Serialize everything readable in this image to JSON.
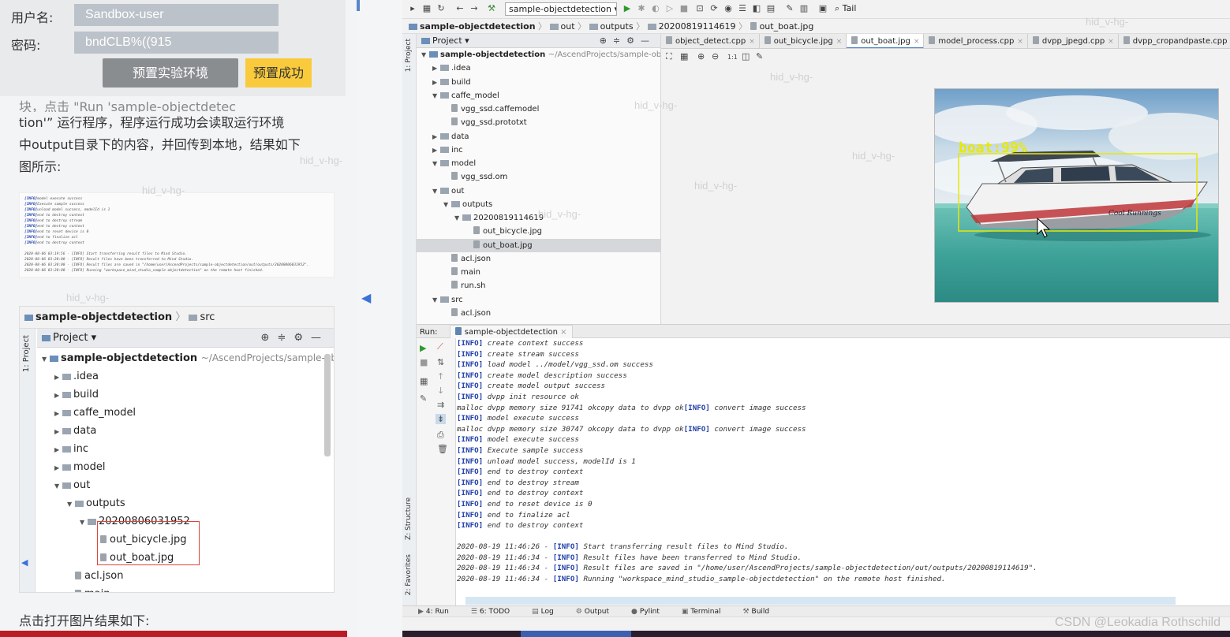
{
  "tutorial": {
    "username_label": "用户名:",
    "username_value": "Sandbox-user",
    "password_label": "密码:",
    "password_value": "bndCLB%((915",
    "preset_button": "预置实验环境",
    "preset_status": "预置成功",
    "paragraph_partial": "块，点击 \"Run 'sample-objectdetec",
    "paragraph_lines": [
      "tion'” 运行程序，程序运行成功会读取运行环境",
      "中output目录下的内容，并回传到本地，结果如下",
      "图所示:"
    ],
    "log_thumb_lines": [
      {
        "tag": "[INFO]",
        "text": "model execute success"
      },
      {
        "tag": "[INFO]",
        "text": "Execute sample success"
      },
      {
        "tag": "[INFO]",
        "text": "unload model success, modelId is 1"
      },
      {
        "tag": "[INFO]",
        "text": "end to destroy context"
      },
      {
        "tag": "[INFO]",
        "text": "end to destroy stream"
      },
      {
        "tag": "[INFO]",
        "text": "end to destroy context"
      },
      {
        "tag": "[INFO]",
        "text": "end to reset device is 0"
      },
      {
        "tag": "[INFO]",
        "text": "end to finalize acl"
      },
      {
        "tag": "[INFO]",
        "text": "end to destroy context"
      },
      {
        "tag": "",
        "text": ""
      },
      {
        "tag": "",
        "text": "2020-08-06 03:19:56 - [INFO] Start transferring result files to Mind Studio."
      },
      {
        "tag": "",
        "text": "2020-08-06 03:20:00 - [INFO] Result files have been transferred to Mind Studio."
      },
      {
        "tag": "",
        "text": "2020-08-06 03:20:00 - [INFO] Result files are saved in \"/home/user/AscendProjects/sample-objectdetection/out/outputs/20200806031952\"."
      },
      {
        "tag": "",
        "text": "2020-08-06 03:20:00 - [INFO] Running \"workspace_mind_studio_sample-objectdetection\" on the remote host finished."
      }
    ],
    "tree_shot": {
      "breadcrumb_project": "sample-objectdetection",
      "breadcrumb_folder": "src",
      "sidebar_label": "1: Project",
      "header": "Project",
      "rows": [
        {
          "label": "sample-objectdetection",
          "path": "~/AscendProjects/sample-objec",
          "indent": 0,
          "kind": "project",
          "open": true
        },
        {
          "label": ".idea",
          "indent": 1,
          "kind": "folder",
          "open": false
        },
        {
          "label": "build",
          "indent": 1,
          "kind": "folder",
          "open": false
        },
        {
          "label": "caffe_model",
          "indent": 1,
          "kind": "folder",
          "open": false
        },
        {
          "label": "data",
          "indent": 1,
          "kind": "folder",
          "open": false
        },
        {
          "label": "inc",
          "indent": 1,
          "kind": "folder",
          "open": false
        },
        {
          "label": "model",
          "indent": 1,
          "kind": "folder",
          "open": false
        },
        {
          "label": "out",
          "indent": 1,
          "kind": "folder",
          "open": true
        },
        {
          "label": "outputs",
          "indent": 2,
          "kind": "folder",
          "open": true
        },
        {
          "label": "20200806031952",
          "indent": 3,
          "kind": "folder",
          "open": true
        },
        {
          "label": "out_bicycle.jpg",
          "indent": 4,
          "kind": "file"
        },
        {
          "label": "out_boat.jpg",
          "indent": 4,
          "kind": "file"
        },
        {
          "label": "acl.json",
          "indent": 2,
          "kind": "file"
        },
        {
          "label": "main",
          "indent": 2,
          "kind": "file"
        }
      ]
    },
    "footer_text": "点击打开图片结果如下:"
  },
  "ide": {
    "run_config": "sample-objectdetection",
    "tail_label": "Tail",
    "breadcrumb": {
      "project": "sample-objectdetection",
      "seg1": "out",
      "seg2": "outputs",
      "seg3": "20200819114619",
      "file": "out_boat.jpg"
    },
    "left_strip": {
      "project": "1: Project",
      "structure": "Z: Structure",
      "favorites": "2: Favorites"
    },
    "project_panel": {
      "header": "Project",
      "rows": [
        {
          "label": "sample-objectdetection",
          "path": "~/AscendProjects/sample-objectdet",
          "indent": 0,
          "kind": "project",
          "open": true
        },
        {
          "label": ".idea",
          "indent": 1,
          "kind": "folder",
          "open": false
        },
        {
          "label": "build",
          "indent": 1,
          "kind": "folder",
          "open": false
        },
        {
          "label": "caffe_model",
          "indent": 1,
          "kind": "folder",
          "open": true
        },
        {
          "label": "vgg_ssd.caffemodel",
          "indent": 2,
          "kind": "file"
        },
        {
          "label": "vgg_ssd.prototxt",
          "indent": 2,
          "kind": "file"
        },
        {
          "label": "data",
          "indent": 1,
          "kind": "folder",
          "open": false
        },
        {
          "label": "inc",
          "indent": 1,
          "kind": "folder",
          "open": false
        },
        {
          "label": "model",
          "indent": 1,
          "kind": "folder",
          "open": true
        },
        {
          "label": "vgg_ssd.om",
          "indent": 2,
          "kind": "file"
        },
        {
          "label": "out",
          "indent": 1,
          "kind": "folder",
          "open": true
        },
        {
          "label": "outputs",
          "indent": 2,
          "kind": "folder",
          "open": true
        },
        {
          "label": "20200819114619",
          "indent": 3,
          "kind": "folder",
          "open": true
        },
        {
          "label": "out_bicycle.jpg",
          "indent": 4,
          "kind": "file"
        },
        {
          "label": "out_boat.jpg",
          "indent": 4,
          "kind": "file",
          "selected": true
        },
        {
          "label": "acl.json",
          "indent": 2,
          "kind": "file"
        },
        {
          "label": "main",
          "indent": 2,
          "kind": "file"
        },
        {
          "label": "run.sh",
          "indent": 2,
          "kind": "file"
        },
        {
          "label": "src",
          "indent": 1,
          "kind": "folder",
          "open": true
        },
        {
          "label": "acl.json",
          "indent": 2,
          "kind": "file"
        }
      ]
    },
    "editor_tabs": [
      {
        "label": "object_detect.cpp",
        "active": false
      },
      {
        "label": "out_bicycle.jpg",
        "active": false
      },
      {
        "label": "out_boat.jpg",
        "active": true
      },
      {
        "label": "model_process.cpp",
        "active": false
      },
      {
        "label": "dvpp_jpegd.cpp",
        "active": false
      },
      {
        "label": "dvpp_cropandpaste.cpp",
        "active": false
      }
    ],
    "image_zoom_label": "1:1",
    "detection": {
      "label": "boat:99%",
      "box_color": "#e8e800"
    },
    "boat_name": "Cool Runnings",
    "run_label": "Run:",
    "run_tab": "sample-objectdetection",
    "console_lines": [
      {
        "pre": "",
        "tag": "[INFO]",
        "text": "  create context success"
      },
      {
        "pre": "",
        "tag": "[INFO]",
        "text": "  create stream success"
      },
      {
        "pre": "",
        "tag": "[INFO]",
        "text": "  load model ../model/vgg_ssd.om success"
      },
      {
        "pre": "",
        "tag": "[INFO]",
        "text": "  create model description success"
      },
      {
        "pre": "",
        "tag": "[INFO]",
        "text": "  create model output success"
      },
      {
        "pre": "",
        "tag": "[INFO]",
        "text": "  dvpp init resource ok"
      },
      {
        "pre": "malloc dvpp memory size 91741 okcopy data to dvpp ok",
        "tag": "[INFO]",
        "text": "  convert image success"
      },
      {
        "pre": "",
        "tag": "[INFO]",
        "text": "  model execute success"
      },
      {
        "pre": "malloc dvpp memory size 30747 okcopy data to dvpp ok",
        "tag": "[INFO]",
        "text": "  convert image success"
      },
      {
        "pre": "",
        "tag": "[INFO]",
        "text": "  model execute success"
      },
      {
        "pre": "",
        "tag": "[INFO]",
        "text": "  Execute sample success"
      },
      {
        "pre": "",
        "tag": "[INFO]",
        "text": "  unload model success, modelId is 1"
      },
      {
        "pre": "",
        "tag": "[INFO]",
        "text": "  end to destroy context"
      },
      {
        "pre": "",
        "tag": "[INFO]",
        "text": "  end to destroy stream"
      },
      {
        "pre": "",
        "tag": "[INFO]",
        "text": "  end to destroy context"
      },
      {
        "pre": "",
        "tag": "[INFO]",
        "text": "  end to reset device is 0"
      },
      {
        "pre": "",
        "tag": "[INFO]",
        "text": "  end to finalize acl"
      },
      {
        "pre": "",
        "tag": "[INFO]",
        "text": "  end to destroy context"
      },
      {
        "pre": "",
        "tag": "",
        "text": ""
      },
      {
        "pre": "2020-08-19 11:46:26 - ",
        "tag": "[INFO]",
        "text": " Start transferring result files to Mind Studio."
      },
      {
        "pre": "2020-08-19 11:46:34 - ",
        "tag": "[INFO]",
        "text": " Result files have been transferred to Mind Studio."
      },
      {
        "pre": "2020-08-19 11:46:34 - ",
        "tag": "[INFO]",
        "text": " Result files are saved in \"/home/user/AscendProjects/sample-objectdetection/out/outputs/20200819114619\"."
      },
      {
        "pre": "2020-08-19 11:46:34 - ",
        "tag": "[INFO]",
        "text": " Running \"workspace_mind_studio_sample-objectdetection\" on the remote host finished."
      }
    ],
    "status_tabs": [
      "4: Run",
      "6: TODO",
      "Log",
      "Output",
      "Pylint",
      "Terminal",
      "Build"
    ],
    "watermark_csdn": "CSDN @Leokadia Rothschild",
    "watermark_text": "hid_v-hg-"
  }
}
